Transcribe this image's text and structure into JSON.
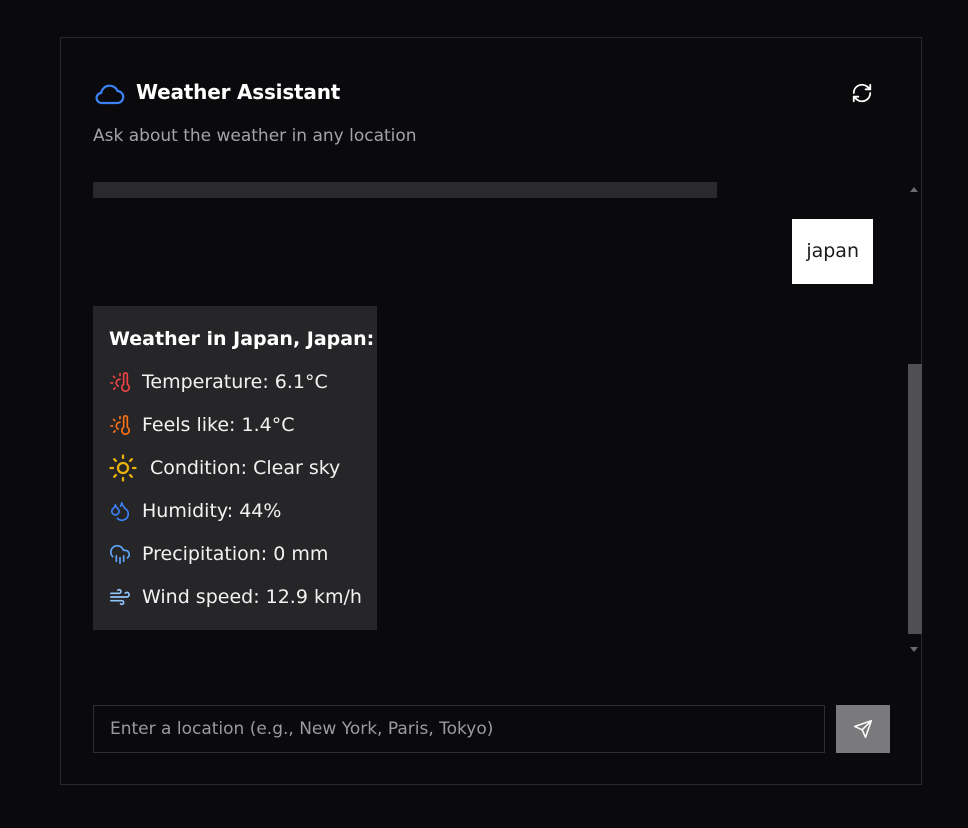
{
  "header": {
    "title": "Weather Assistant",
    "subtitle": "Ask about the weather in any location",
    "app_icon": "cloud-icon",
    "refresh_icon": "refresh-icon"
  },
  "chat": {
    "user_message": "japan",
    "bot_reply": {
      "title": "Weather in Japan, Japan:",
      "rows": [
        {
          "icon": "thermometer-sun-icon",
          "color": "#ef4444",
          "text": "Temperature: 6.1°C"
        },
        {
          "icon": "thermometer-sun-icon",
          "color": "#f97316",
          "text": "Feels like: 1.4°C"
        },
        {
          "icon": "sun-icon",
          "color": "#eab308",
          "text": "Condition: Clear sky"
        },
        {
          "icon": "droplets-icon",
          "color": "#3b82f6",
          "text": "Humidity: 44%"
        },
        {
          "icon": "cloud-rain-icon",
          "color": "#60a5fa",
          "text": "Precipitation: 0 mm"
        },
        {
          "icon": "wind-icon",
          "color": "#93c5fd",
          "text": "Wind speed: 12.9 km/h"
        }
      ]
    }
  },
  "input": {
    "placeholder": "Enter a location (e.g., New York, Paris, Tokyo)",
    "value": "",
    "send_icon": "send-icon"
  },
  "colors": {
    "background": "#0a0a0c",
    "accent": "#3b82f6",
    "bot_bubble": "#262628",
    "user_bubble": "#ffffff",
    "send_button": "#7a7a7c"
  }
}
